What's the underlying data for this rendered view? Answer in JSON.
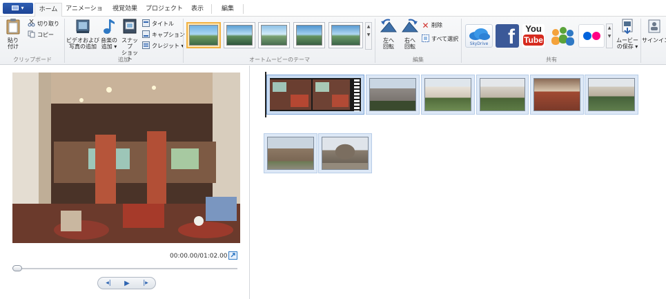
{
  "app_menu": {
    "label": ""
  },
  "tabs": [
    {
      "label": "ホーム",
      "active": true
    },
    {
      "label": "アニメーション",
      "active": false
    },
    {
      "label": "視覚効果",
      "active": false
    },
    {
      "label": "プロジェクト",
      "active": false
    },
    {
      "label": "表示",
      "active": false
    },
    {
      "label": "編集",
      "active": false
    }
  ],
  "clipboard": {
    "group_label": "クリップボード",
    "paste_line1": "貼り",
    "paste_line2": "付け",
    "cut": "切り取り",
    "copy": "コピー"
  },
  "add": {
    "group_label": "追加",
    "video_line1": "ビデオおよび",
    "video_line2": "写真の追加",
    "music_line1": "音楽の",
    "music_line2": "追加 ▾",
    "snapshot_line1": "スナップ",
    "snapshot_line2": "ショット",
    "title": "タイトル",
    "caption": "キャプション",
    "credits": "クレジット ▾"
  },
  "themes": {
    "group_label": "オートムービーのテーマ"
  },
  "editing": {
    "group_label": "編集",
    "rotate_left_line1": "左へ",
    "rotate_left_line2": "回転",
    "rotate_right_line1": "右へ",
    "rotate_right_line2": "回転",
    "delete": "削除",
    "select_all": "すべて選択"
  },
  "share": {
    "group_label": "共有",
    "skydrive": "SkyDrive",
    "facebook": "f",
    "youtube_line1": "You",
    "youtube_line2": "Tube",
    "save_line1": "ムービー",
    "save_line2": "の保存 ▾",
    "sign_in": "サインイン"
  },
  "player": {
    "timecode": "00:00.00/01:02.00",
    "prev": "◂|",
    "play": "▶",
    "next": "|▸"
  },
  "colors": {
    "accent": "#2f65b1",
    "selection": "#f2b243"
  }
}
